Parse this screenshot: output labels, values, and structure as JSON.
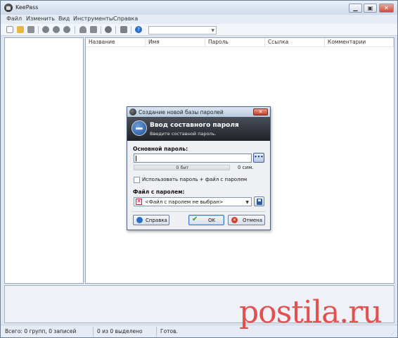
{
  "app": {
    "title": "KeePass"
  },
  "window_buttons": {
    "minimize": "▁",
    "maximize": "▣",
    "close": "✕"
  },
  "menu": [
    "Файл",
    "Изменить",
    "Вид",
    "Инструменты",
    "Справка"
  ],
  "toolbar": {
    "icons": [
      "new-file-icon",
      "open-folder-icon",
      "save-icon",
      "add-entry-icon",
      "edit-entry-icon",
      "delete-entry-icon",
      "user-icon",
      "url-icon",
      "search-icon",
      "lock-icon",
      "help-icon"
    ],
    "combo_value": ""
  },
  "columns": [
    "Название",
    "Имя",
    "Пароль",
    "Ссылка",
    "Комментарии"
  ],
  "status": {
    "total": "Всего: 0 групп, 0 записей",
    "selected": "0 из 0 выделено",
    "ready": "Готов."
  },
  "dialog": {
    "title": "Создание новой базы паролей",
    "banner_title": "Ввод составного пароля",
    "banner_subtitle": "Введите составной пароль.",
    "master_password_label": "Основной пароль:",
    "dots_label": "•••",
    "quality_text": "0 бит",
    "chars_text": "0 сим.",
    "checkbox_label": "Использовать пароль + файл с паролем",
    "keyfile_label": "Файл с паролем:",
    "keyfile_value": "<Файл с паролем не выбран>",
    "buttons": {
      "help": "Справка",
      "ok": "OK",
      "cancel": "Отмена"
    },
    "close_label": "✕"
  },
  "watermark": "postila.ru",
  "colors": {
    "banner": "#1f2228",
    "watermark": "#e23a3a",
    "accent": "#3a7bc8"
  }
}
